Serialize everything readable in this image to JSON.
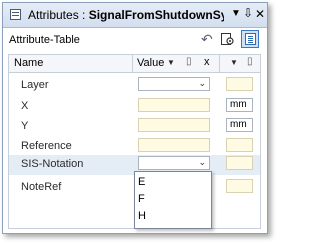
{
  "window": {
    "title_prefix": "Attributes : ",
    "title_name": "SignalFromShutdownSyster",
    "menu_glyph": "▼",
    "pin_glyph": "⇩",
    "close_glyph": "✕"
  },
  "toolbar": {
    "label": "Attribute-Table",
    "undo_glyph": "↶"
  },
  "table": {
    "headers": {
      "name": "Name",
      "value": "Value",
      "x": "x",
      "filter_glyph": "▼",
      "clip_glyph": "▯"
    },
    "rows": [
      {
        "name": "Layer",
        "value_type": "dropdown",
        "arrow": "⌄",
        "unit": ""
      },
      {
        "name": "X",
        "value_type": "text",
        "unit": "mm"
      },
      {
        "name": "Y",
        "value_type": "text",
        "unit": "mm"
      },
      {
        "name": "Reference",
        "value_type": "text",
        "unit": ""
      },
      {
        "name": "SIS-Notation",
        "value_type": "dropdown",
        "arrow": "⌄",
        "unit": "",
        "selected": true
      },
      {
        "name": "NoteRef",
        "value_type": "text",
        "unit": ""
      }
    ]
  },
  "dropdown": {
    "options": [
      "E",
      "F",
      "H"
    ]
  },
  "colors": {
    "titlebar": "#dbe4f2",
    "value_cell": "#fffbe3",
    "selected_row": "#e4ecf6",
    "active_tool": "#cfe1f7"
  }
}
